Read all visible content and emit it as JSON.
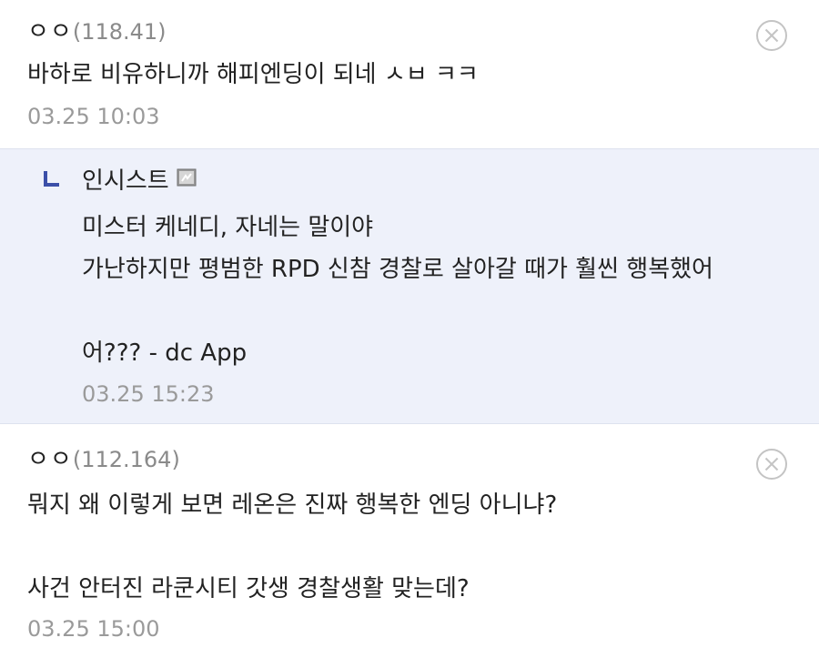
{
  "comments": [
    {
      "nickname": "ㅇㅇ",
      "ip": "(118.41)",
      "body": "바하로 비유하니까 해피엔딩이 되네 ㅅㅂ ㅋㅋ",
      "date": "03.25 10:03"
    },
    {
      "nickname": "ㅇㅇ",
      "ip": "(112.164)",
      "body": "뭐지 왜 이렇게 보면 레온은 진짜 행복한 엔딩 아니냐?\n\n사건 안터진 라쿤시티 갓생 경찰생활 맞는데?",
      "date": "03.25 15:00"
    }
  ],
  "reply": {
    "nickname": "인시스트",
    "body": "미스터 케네디, 자네는 말이야\n가난하지만 평범한 RPD 신참 경찰로 살아갈 때가 훨씬 행복했어\n\n어??? - dc App",
    "date": "03.25 15:23"
  },
  "icons": {
    "delete": "close-circle-icon",
    "reply": "reply-arrow-icon",
    "member": "fixed-nick-icon"
  },
  "colors": {
    "reply_background": "#eef1fa",
    "reply_arrow": "#3b4fa8",
    "meta_gray": "#9a9a9a"
  }
}
